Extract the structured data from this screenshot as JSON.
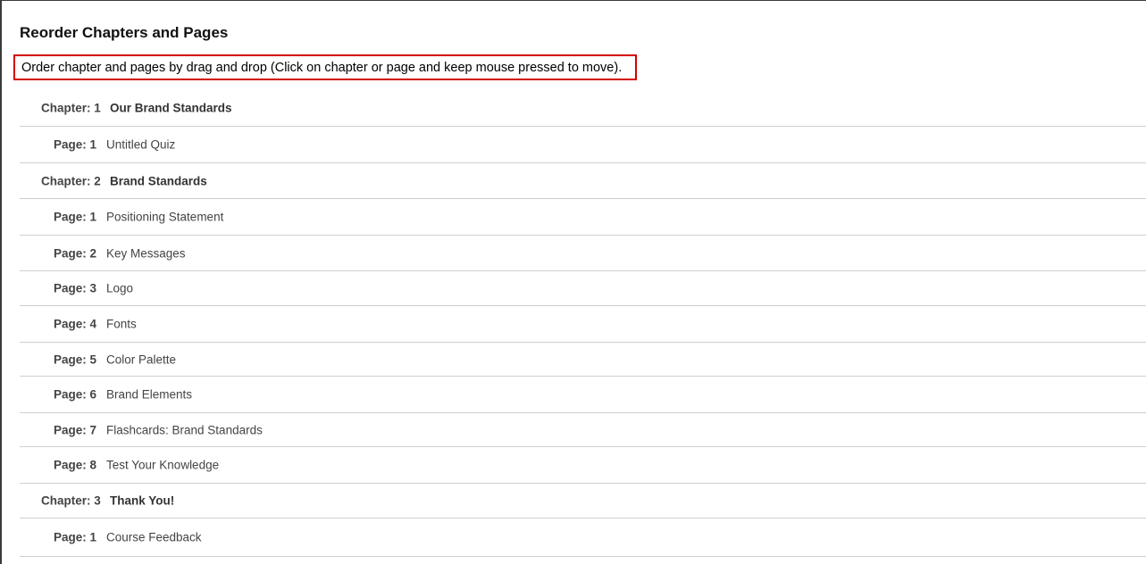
{
  "header": {
    "title": "Reorder Chapters and Pages",
    "instruction": "Order chapter and pages by drag and drop (Click on chapter or page and keep mouse pressed to move)."
  },
  "items": [
    {
      "kind": "chapter",
      "label": "Chapter: 1",
      "title": "Our Brand Standards"
    },
    {
      "kind": "page",
      "label": "Page: 1",
      "title": "Untitled Quiz"
    },
    {
      "kind": "chapter",
      "label": "Chapter: 2",
      "title": "Brand Standards"
    },
    {
      "kind": "page",
      "label": "Page: 1",
      "title": "Positioning Statement"
    },
    {
      "kind": "page",
      "label": "Page: 2",
      "title": "Key Messages"
    },
    {
      "kind": "page",
      "label": "Page: 3",
      "title": "Logo"
    },
    {
      "kind": "page",
      "label": "Page: 4",
      "title": "Fonts"
    },
    {
      "kind": "page",
      "label": "Page: 5",
      "title": "Color Palette"
    },
    {
      "kind": "page",
      "label": "Page: 6",
      "title": "Brand Elements"
    },
    {
      "kind": "page",
      "label": "Page: 7",
      "title": "Flashcards: Brand Standards"
    },
    {
      "kind": "page",
      "label": "Page: 8",
      "title": "Test Your Knowledge"
    },
    {
      "kind": "chapter",
      "label": "Chapter: 3",
      "title": "Thank You!"
    },
    {
      "kind": "page",
      "label": "Page: 1",
      "title": "Course Feedback"
    }
  ]
}
